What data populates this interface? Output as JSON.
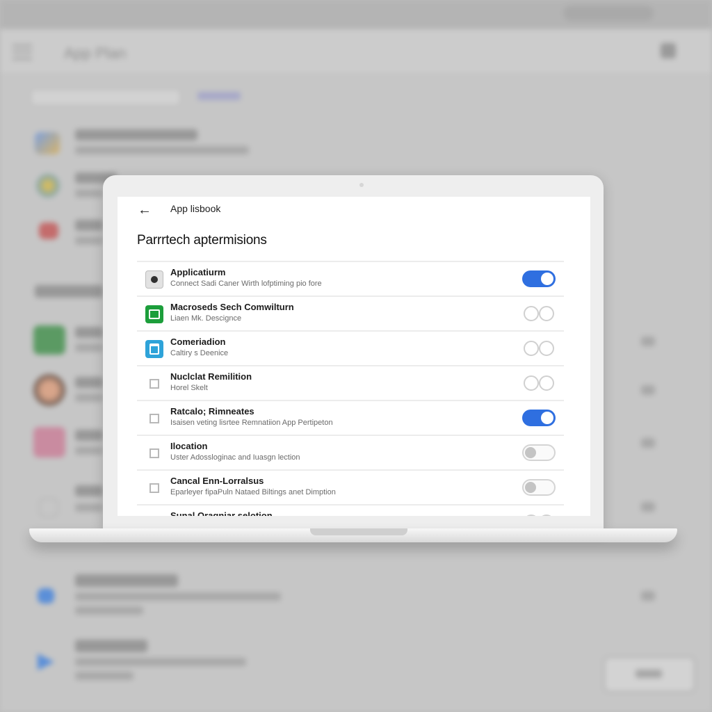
{
  "background": {
    "title": "App Plan"
  },
  "screen": {
    "header_title": "App lisbook",
    "back_icon": "arrow-left-icon",
    "page_title": "Parrrtech aptermisions"
  },
  "permissions": [
    {
      "name": "Applicatiurm",
      "desc": "Connect Sadi Caner Wirth lofptiming pio fore",
      "icon": "app-icon",
      "toggle": "on"
    },
    {
      "name": "Macroseds Sech Comwilturn",
      "desc": "Liaen Mk. Descignce",
      "icon": "grid-app-icon",
      "toggle": "off"
    },
    {
      "name": "Comeriadion",
      "desc": "Caltiry s Deenice",
      "icon": "camera-app-icon",
      "toggle": "off"
    },
    {
      "name": "Nuclclat Remilition",
      "desc": "Horel Skelt",
      "icon": "generic-app-icon",
      "toggle": "off"
    },
    {
      "name": "Ratcalo; Rimneates",
      "desc": "Isaisen veting lisrtee Remnatiion App Pertipeton",
      "icon": "generic-app-icon",
      "toggle": "on"
    },
    {
      "name": "Ilocation",
      "desc": "Uster Adossloginac and Iuasgn lection",
      "icon": "generic-app-icon",
      "toggle": "dim"
    },
    {
      "name": "Cancal Enn-Lorralsus",
      "desc": "Eparleyer fipaPuln Nataed Biltings anet Dimption",
      "icon": "generic-app-icon",
      "toggle": "dim"
    },
    {
      "name": "Sunal Oragniar selotion",
      "desc": "",
      "icon": "generic-app-icon",
      "toggle": "off"
    }
  ],
  "colors": {
    "toggle_on": "#2f6fe0",
    "icon_green": "#1c9e3b",
    "icon_blue": "#2ea3d9"
  }
}
